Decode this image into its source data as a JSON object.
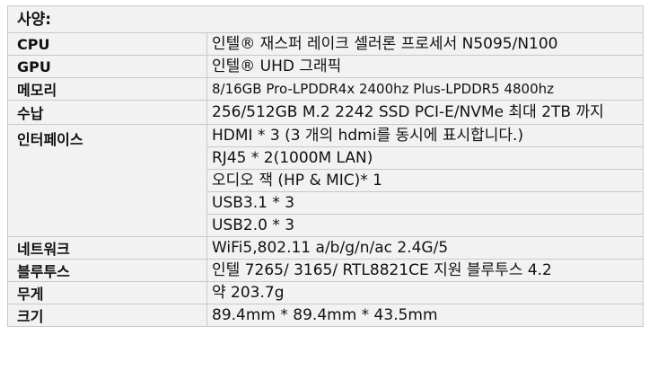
{
  "heading": "사양:",
  "rows": [
    {
      "label": "CPU",
      "values": [
        "인텔® 재스퍼 레이크 셀러론 프로세서 N5095/N100"
      ]
    },
    {
      "label": "GPU",
      "values": [
        "인텔® UHD 그래픽"
      ]
    },
    {
      "label": "메모리",
      "values": [
        "8/16GB Pro-LPDDR4x 2400hz Plus-LPDDR5 4800hz"
      ]
    },
    {
      "label": "수납",
      "values": [
        "256/512GB M.2 2242 SSD PCI-E/NVMe 최대 2TB 까지"
      ]
    },
    {
      "label": "인터페이스",
      "values": [
        "HDMI * 3 (3 개의 hdmi를 동시에 표시합니다.)",
        "RJ45 * 2(1000M LAN)",
        "오디오 잭 (HP & MIC)* 1",
        "USB3.1 * 3",
        "USB2.0 * 3"
      ]
    },
    {
      "label": "네트워크",
      "values": [
        "WiFi5,802.11 a/b/g/n/ac 2.4G/5"
      ]
    },
    {
      "label": "블루투스",
      "values": [
        "인텔 7265/ 3165/ RTL8821CE 지원 블루투스 4.2"
      ]
    },
    {
      "label": "무게",
      "values": [
        "약 203.7g"
      ]
    },
    {
      "label": "크기",
      "values": [
        "89.4mm * 89.4mm * 43.5mm"
      ]
    }
  ]
}
